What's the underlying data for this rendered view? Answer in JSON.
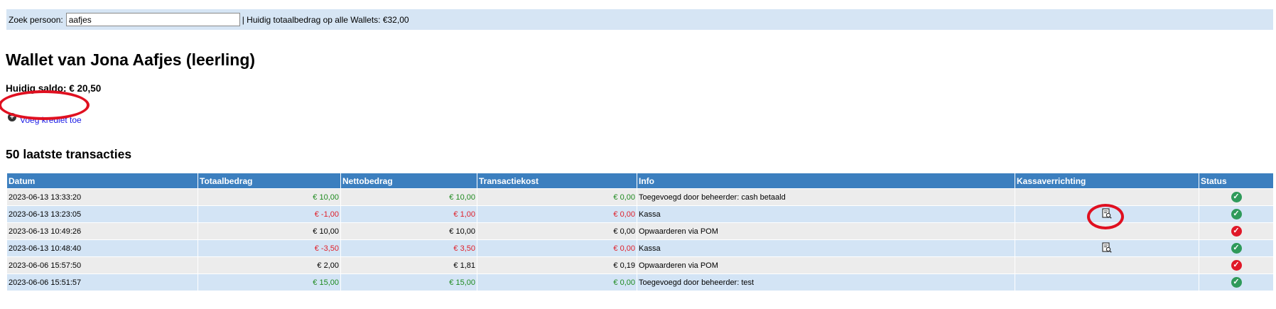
{
  "search": {
    "label": "Zoek persoon:",
    "value": "aafjes",
    "total_text": "| Huidig totaalbedrag op alle Wallets: €32,00"
  },
  "wallet": {
    "title": "Wallet van Jona Aafjes (leerling)",
    "balance_label": "Huidig saldo:",
    "balance_value": "€ 20,50",
    "add_credit": "Voeg krediet toe"
  },
  "transactions": {
    "heading": "50 laatste transacties",
    "columns": [
      "Datum",
      "Totaalbedrag",
      "Nettobedrag",
      "Transactiekost",
      "Info",
      "Kassaverrichting",
      "Status"
    ],
    "rows": [
      {
        "date": "2023-06-13 13:33:20",
        "total": "€ 10,00",
        "net": "€ 10,00",
        "fee": "€ 0,00",
        "info": "Toegevoegd door beheerder: cash betaald",
        "tone": "pos",
        "receipt": false,
        "status": "ok"
      },
      {
        "date": "2023-06-13 13:23:05",
        "total": "€ -1,00",
        "net": "€ 1,00",
        "fee": "€ 0,00",
        "info": "Kassa",
        "tone": "neg",
        "receipt": true,
        "status": "ok"
      },
      {
        "date": "2023-06-13 10:49:26",
        "total": "€ 10,00",
        "net": "€ 10,00",
        "fee": "€ 0,00",
        "info": "Opwaarderen via POM",
        "tone": "neutral",
        "receipt": false,
        "status": "fail"
      },
      {
        "date": "2023-06-13 10:48:40",
        "total": "€ -3,50",
        "net": "€ 3,50",
        "fee": "€ 0,00",
        "info": "Kassa",
        "tone": "neg",
        "receipt": true,
        "status": "ok"
      },
      {
        "date": "2023-06-06 15:57:50",
        "total": "€ 2,00",
        "net": "€ 1,81",
        "fee": "€ 0,19",
        "info": "Opwaarderen via POM",
        "tone": "neutral",
        "receipt": false,
        "status": "fail"
      },
      {
        "date": "2023-06-06 15:51:57",
        "total": "€ 15,00",
        "net": "€ 15,00",
        "fee": "€ 0,00",
        "info": "Toegevoegd door beheerder: test",
        "tone": "pos",
        "receipt": false,
        "status": "ok"
      }
    ]
  },
  "icons": {
    "add": "plus-circle-icon",
    "receipt": "receipt-search-icon",
    "status_ok": "check-circle-icon",
    "status_fail": "check-circle-red-icon"
  },
  "colors": {
    "header_bg": "#3c7fbf",
    "topbar_bg": "#d6e5f4",
    "positive": "#1e8a1e",
    "negative": "#e0202a",
    "status_ok": "#2f9a5a",
    "status_fail": "#e01828",
    "highlight": "#e01020"
  }
}
